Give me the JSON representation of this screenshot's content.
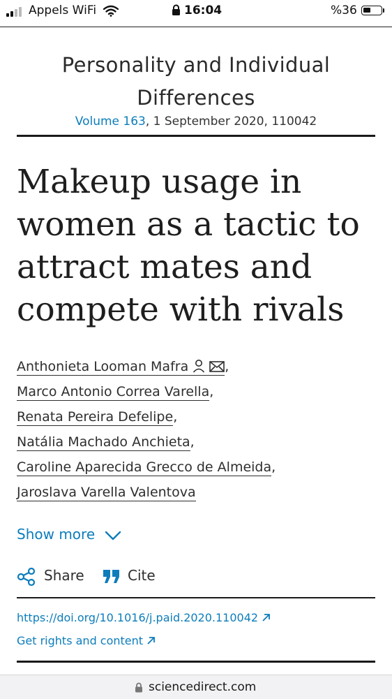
{
  "status_bar": {
    "carrier": "Appels WiFi",
    "time": "16:04",
    "battery": "%36"
  },
  "journal": {
    "title_line1": "Personality and Individual",
    "title_line2": "Differences",
    "volume_link": "Volume 163",
    "date_info": ", 1 September 2020, 110042"
  },
  "article": {
    "title_lines": [
      "Makeup usage in",
      "women as a tactic to",
      "attract mates and",
      "compete with rivals"
    ]
  },
  "authors": [
    {
      "name": "Anthonieta Looman Mafra",
      "sep": ","
    },
    {
      "name": "Marco Antonio Correa Varella",
      "sep": ","
    },
    {
      "name": "Renata Pereira Defelipe",
      "sep": ","
    },
    {
      "name": "Natália Machado Anchieta",
      "sep": ","
    },
    {
      "name": "Caroline Aparecida Grecco de Almeida",
      "sep": ","
    },
    {
      "name": "Jaroslava Varella Valentova",
      "sep": ""
    }
  ],
  "actions": {
    "show_more": "Show more",
    "share": "Share",
    "cite": "Cite"
  },
  "links": {
    "doi": "https://doi.org/10.1016/j.paid.2020.110042",
    "rights": "Get rights and content"
  },
  "browser": {
    "url": "sciencedirect.com"
  },
  "icons": {
    "signal": "signal-bars-icon",
    "wifi": "wifi-icon",
    "lock": "lock-icon",
    "battery": "battery-icon",
    "person": "person-icon",
    "mail": "mail-icon",
    "chevron": "chevron-down-icon",
    "share": "share-icon",
    "cite": "quote-icon",
    "external": "external-link-icon"
  },
  "colors": {
    "link": "#0c7dbb",
    "text": "#1f1f1f",
    "rule": "#1a1a1a"
  }
}
